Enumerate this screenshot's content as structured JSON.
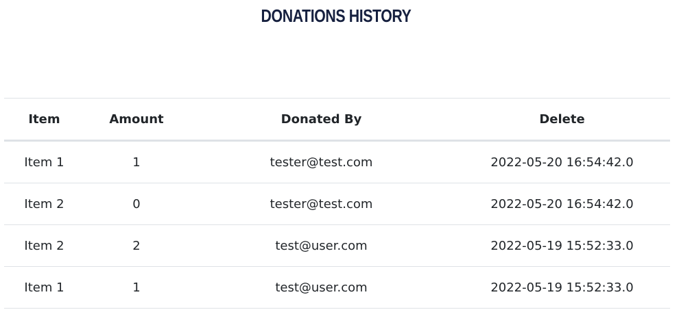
{
  "page": {
    "title": "DONATIONS HISTORY"
  },
  "table": {
    "headers": [
      "Item",
      "Amount",
      "Donated By",
      "Delete"
    ],
    "rows": [
      [
        "Item 1",
        "1",
        "tester@test.com",
        "2022-05-20 16:54:42.0"
      ],
      [
        "Item 2",
        "0",
        "tester@test.com",
        "2022-05-20 16:54:42.0"
      ],
      [
        "Item 2",
        "2",
        "test@user.com",
        "2022-05-19 15:52:33.0"
      ],
      [
        "Item 1",
        "1",
        "test@user.com",
        "2022-05-19 15:52:33.0"
      ]
    ]
  },
  "colors": {
    "title": "#16203f",
    "text": "#212529",
    "border": "#dee2e6"
  }
}
